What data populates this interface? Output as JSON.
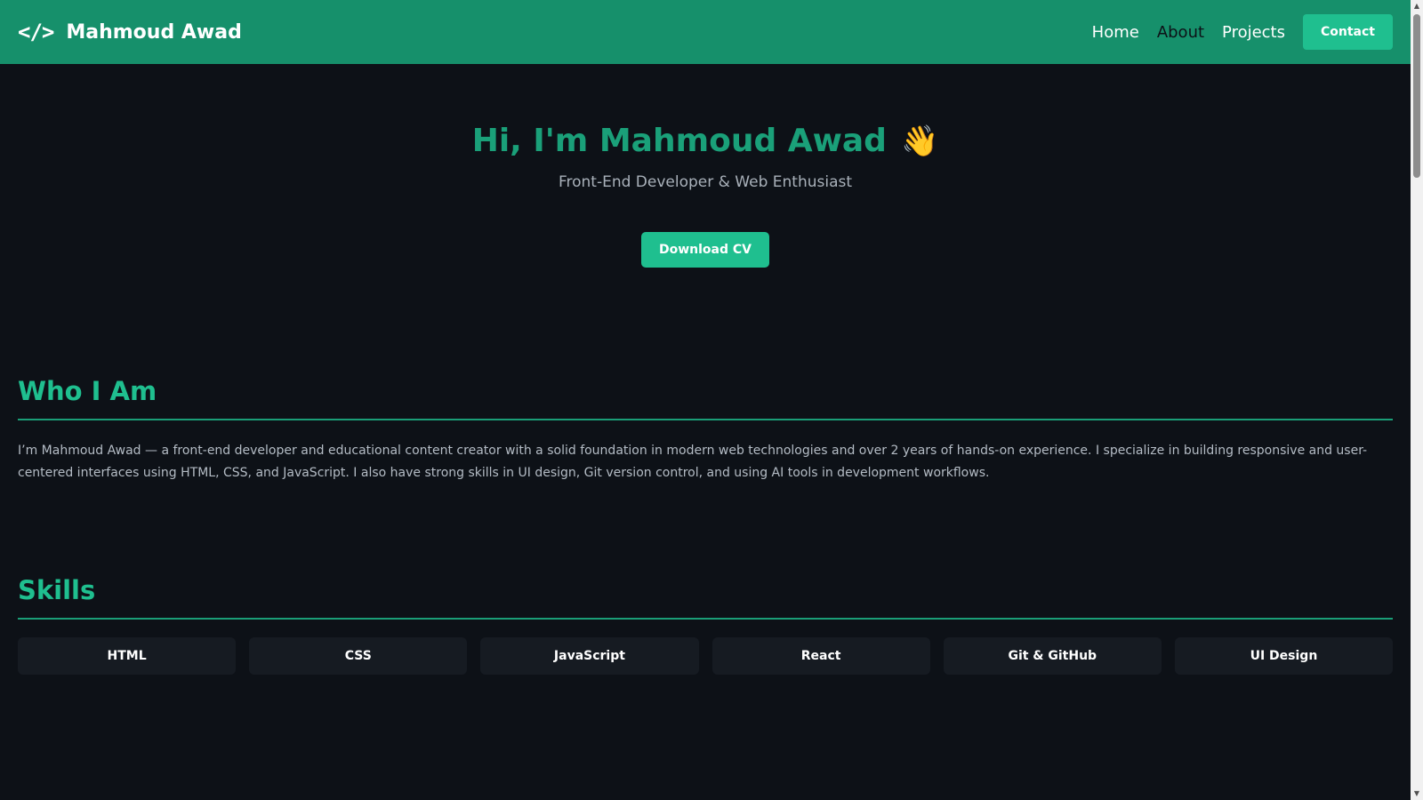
{
  "navbar": {
    "brand_icon": "</>",
    "brand_name": "Mahmoud Awad",
    "links": [
      "Home",
      "About",
      "Projects"
    ],
    "contact_label": "Contact"
  },
  "hero": {
    "title": "Hi, I'm Mahmoud Awad",
    "wave_emoji": "👋",
    "subtitle": "Front-End Developer & Web Enthusiast",
    "cv_label": "Download CV"
  },
  "about": {
    "title": "Who I Am",
    "text": "I’m Mahmoud Awad — a front-end developer and educational content creator with a solid foundation in modern web technologies and over 2 years of hands-on experience. I specialize in building responsive and user-centered interfaces using HTML, CSS, and JavaScript. I also have strong skills in UI design, Git version control, and using AI tools in development workflows."
  },
  "skills": {
    "title": "Skills",
    "items": [
      "HTML",
      "CSS",
      "JavaScript",
      "React",
      "Git & GitHub",
      "UI Design"
    ]
  },
  "colors": {
    "navbar": "#16906b",
    "accent": "#1fbf8f",
    "background": "#0d1117",
    "card": "#161b22"
  }
}
